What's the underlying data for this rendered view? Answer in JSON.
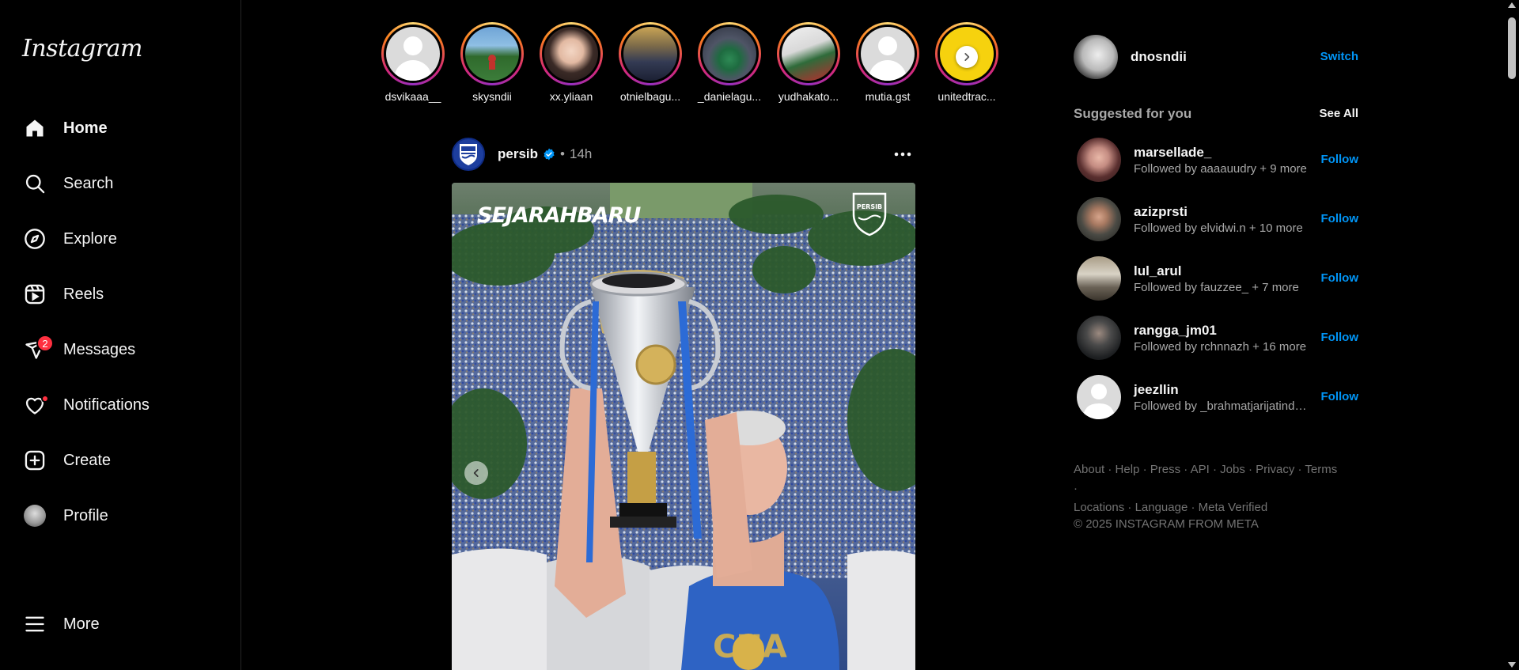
{
  "app": {
    "logo_text": "Instagram"
  },
  "nav": {
    "items": [
      {
        "label": "Home",
        "icon": "home-icon"
      },
      {
        "label": "Search",
        "icon": "search-icon"
      },
      {
        "label": "Explore",
        "icon": "compass-icon"
      },
      {
        "label": "Reels",
        "icon": "reels-icon"
      },
      {
        "label": "Messages",
        "icon": "messenger-icon",
        "badge": "2"
      },
      {
        "label": "Notifications",
        "icon": "heart-icon"
      },
      {
        "label": "Create",
        "icon": "plus-square-icon"
      },
      {
        "label": "Profile",
        "icon": "avatar"
      },
      {
        "label": "More",
        "icon": "menu-icon"
      }
    ]
  },
  "stories": [
    {
      "username": "dsvikaaa__"
    },
    {
      "username": "skysndii"
    },
    {
      "username": "xx.yliaan"
    },
    {
      "username": "otnielbagu..."
    },
    {
      "username": "_danielagu..."
    },
    {
      "username": "yudhakato..."
    },
    {
      "username": "mutia.gst"
    },
    {
      "username": "unitedtrac..."
    }
  ],
  "post": {
    "username": "persib",
    "separator": "•",
    "time": "14h",
    "image_text": "SEJARAHBARU",
    "club_mark": "PERSIB"
  },
  "right": {
    "me": {
      "username": "dnosndii",
      "switch_label": "Switch"
    },
    "suggested_title": "Suggested for you",
    "see_all": "See All",
    "follow_label": "Follow",
    "suggestions": [
      {
        "username": "marsellade_",
        "subtitle": "Followed by aaaauudry + 9 more"
      },
      {
        "username": "azizprsti",
        "subtitle": "Followed by elvidwi.n + 10 more"
      },
      {
        "username": "lul_arul",
        "subtitle": "Followed by fauzzee_ + 7 more"
      },
      {
        "username": "rangga_jm01",
        "subtitle": "Followed by rchnnazh + 16 more"
      },
      {
        "username": "jeezllin",
        "subtitle": "Followed by _brahmatjarijatindr..."
      }
    ],
    "footer_links": [
      "About",
      "Help",
      "Press",
      "API",
      "Jobs",
      "Privacy",
      "Terms",
      "Locations",
      "Language",
      "Meta Verified"
    ],
    "copyright": "© 2025 INSTAGRAM FROM META"
  },
  "colors": {
    "accent": "#0095f6",
    "badge": "#ff3040",
    "background": "#000000",
    "secondary_text": "#a8a8a8"
  }
}
